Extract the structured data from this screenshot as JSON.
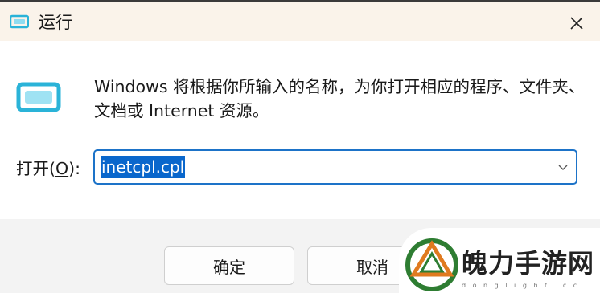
{
  "window": {
    "title": "运行",
    "close_icon": "close-icon"
  },
  "dialog": {
    "description": "Windows 将根据你所输入的名称，为你打开相应的程序、文件夹、文档或 Internet 资源。",
    "open_label_prefix": "打开(",
    "open_label_mnemonic": "O",
    "open_label_suffix": "):",
    "command_value": "inetcpl.cpl",
    "dropdown_icon": "chevron-down-icon"
  },
  "buttons": {
    "ok": "确定",
    "cancel": "取消"
  },
  "watermark": {
    "brand": "魄力手游网",
    "sub": "d o n g l i g h t . c c"
  },
  "colors": {
    "titlebar": "#faf3ea",
    "accent": "#1d73c8",
    "selection": "#0a67cc",
    "icon": "#2ab3d8",
    "footer": "#f3f3f3"
  }
}
